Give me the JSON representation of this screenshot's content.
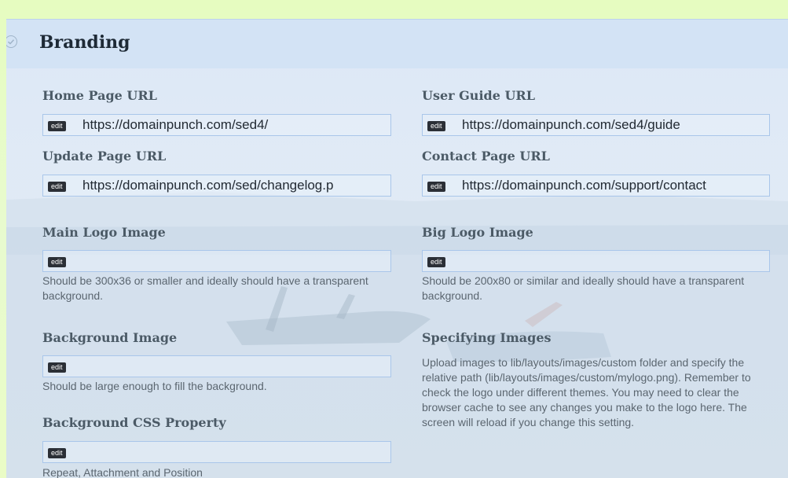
{
  "section": {
    "title": "Branding",
    "icon": "check-circle-icon"
  },
  "fields": {
    "home_page_url": {
      "label": "Home Page URL",
      "edit": "edit",
      "value": "https://domainpunch.com/sed4/"
    },
    "user_guide_url": {
      "label": "User Guide URL",
      "edit": "edit",
      "value": "https://domainpunch.com/sed4/guide"
    },
    "update_page_url": {
      "label": "Update Page URL",
      "edit": "edit",
      "value": "https://domainpunch.com/sed/changelog.p"
    },
    "contact_page_url": {
      "label": "Contact Page URL",
      "edit": "edit",
      "value": "https://domainpunch.com/support/contact"
    },
    "main_logo_image": {
      "label": "Main Logo Image",
      "edit": "edit",
      "value": "",
      "hint": "Should be 300x36 or smaller and ideally should have a transparent background."
    },
    "big_logo_image": {
      "label": "Big Logo Image",
      "edit": "edit",
      "value": "",
      "hint": "Should be 200x80 or similar and ideally should have a transparent background."
    },
    "background_image": {
      "label": "Background Image",
      "edit": "edit",
      "value": "",
      "hint": "Should be large enough to fill the background."
    },
    "background_css": {
      "label": "Background CSS Property",
      "edit": "edit",
      "value": "",
      "hint": "Repeat, Attachment and Position"
    }
  },
  "info": {
    "title": "Specifying Images",
    "text": "Upload images to lib/layouts/images/custom folder and specify the relative path (lib/layouts/images/custom/mylogo.png). Remember to check the logo under different themes. You may need to clear the browser cache to see any changes you make to the logo here. The screen will reload if you change this setting."
  },
  "colors": {
    "panel_background": "#dde8f6",
    "header_background": "#d3e3f5",
    "field_border": "#a9c6ea",
    "edit_badge": "#2b2f36"
  }
}
